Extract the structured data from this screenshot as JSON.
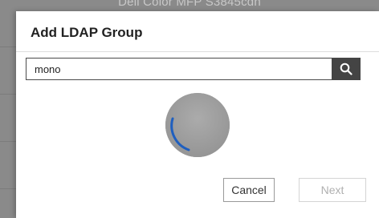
{
  "background": {
    "title": "Dell Color MFP S3845cdn"
  },
  "dialog": {
    "title": "Add LDAP Group",
    "search": {
      "value": "mono",
      "icon": "search-icon"
    },
    "loading": {
      "icon": "spinner-icon"
    },
    "buttons": {
      "cancel": "Cancel",
      "next": "Next"
    }
  },
  "colors": {
    "accent": "#1f5fbf",
    "search_button": "#444444",
    "spinner_fill": "#9e9e9e"
  }
}
